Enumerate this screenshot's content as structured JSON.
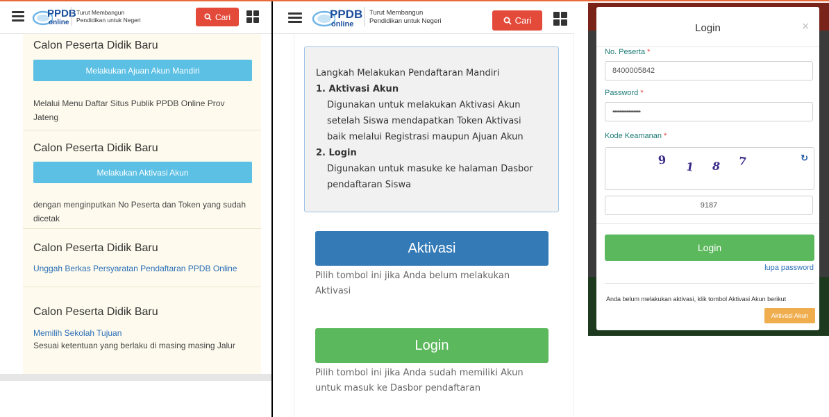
{
  "header": {
    "logo_main": "PPDB",
    "logo_sub": "online",
    "tagline_line1": "Turut Membangun",
    "tagline_line2": "Pendidikan untuk Negeri",
    "search_label": "Cari",
    "menu_icon": "hamburger-icon",
    "apps_icon": "grid-icon",
    "search_icon": "magnifier-icon",
    "accent_color": "#e34a3a"
  },
  "panel1": {
    "cards": [
      {
        "title": "Calon Peserta Didik Baru",
        "button": "Melakukan Ajuan Akun Mandiri",
        "text": "Melalui Menu Daftar Situs Publik PPDB Online Prov Jateng"
      },
      {
        "title": "Calon Peserta Didik Baru",
        "button": "Melakukan Aktivasi Akun",
        "text": "dengan menginputkan No Peserta dan Token yang sudah dicetak"
      },
      {
        "title": "Calon Peserta Didik Baru",
        "link": "Unggah Berkas Persyaratan Pendaftaran PPDB Online"
      },
      {
        "title": "Calon Peserta Didik Baru",
        "link": "Memilih Sekolah Tujuan",
        "text": "Sesuai ketentuan yang berlaku di masing masing Jalur"
      }
    ]
  },
  "panel2": {
    "info": {
      "heading": "Langkah Melakukan Pendaftaran Mandiri",
      "step1_title": "1. Aktivasi Akun",
      "step1_l1": "Digunakan untuk melakukan Aktivasi Akun",
      "step1_l2": "setelah Siswa mendapatkan Token Aktivasi",
      "step1_l3": "baik melalui Registrasi maupun Ajuan Akun",
      "step2_title": "2. Login",
      "step2_l1": "Digunakan untuk masuke ke halaman Dasbor",
      "step2_l2": "pendaftaran Siswa"
    },
    "aktivasi_button": "Aktivasi",
    "aktivasi_hint_l1": "Pilih tombol ini jika Anda belum melakukan",
    "aktivasi_hint_l2": "Aktivasi",
    "login_button": "Login",
    "login_hint_l1": "Pilih tombol ini jika Anda sudah memiliki Akun",
    "login_hint_l2": "untuk masuk ke Dasbor pendaftaran",
    "aktivasi_color": "#337ab7",
    "login_color": "#5cb85c"
  },
  "modal": {
    "title": "Login",
    "close": "×",
    "no_peserta_label": "No. Peserta",
    "no_peserta_value": "8400005842",
    "password_label": "Password",
    "password_value": "••••••••••••••••",
    "kode_label": "Kode Keamanan",
    "required_mark": "*",
    "captcha_digits": [
      "9",
      "1",
      "8",
      "7"
    ],
    "captcha_input": "9187",
    "refresh_icon": "refresh-icon",
    "login_button": "Login",
    "lupa_password": "lupa password",
    "note": "Anda belum melakukan aktivasi, klik tombol Aktivasi Akun berikut",
    "aktivasi_button": "Aktivasi Akun"
  }
}
